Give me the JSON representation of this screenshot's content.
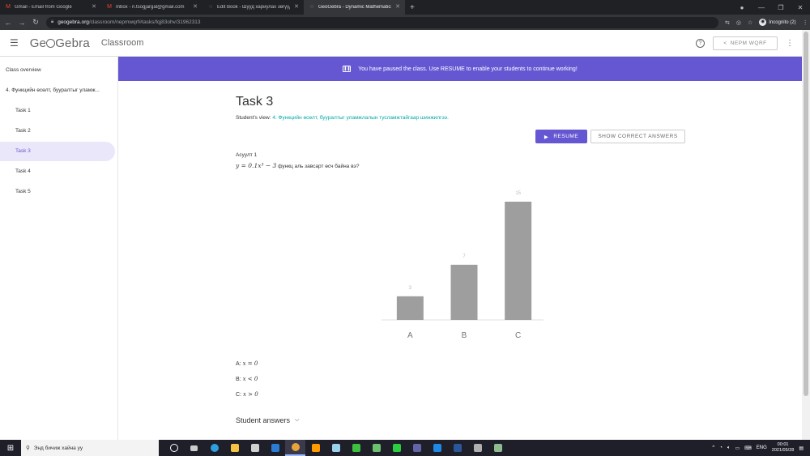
{
  "browser": {
    "tabs": [
      {
        "title": "Gmail - Email from Google",
        "icon": "gmail-icon",
        "active": false
      },
      {
        "title": "Inbox - n.tsogjargal@gmail.com",
        "icon": "gmail-icon",
        "active": false
      },
      {
        "title": "Edit Book - Шууд хариулах зөгүүд",
        "icon": "geogebra-icon",
        "active": false
      },
      {
        "title": "GeoGebra - Dynamic Mathematics",
        "icon": "geogebra-icon",
        "active": true
      }
    ],
    "new_tab": "+",
    "url_domain": "geogebra.org",
    "url_path": "/classroom/nepmwqrf#tasks/fqj83ohv/31962313",
    "profile_label": "Incognito (2)"
  },
  "app": {
    "logo_pre": "Ge",
    "logo_post": "Gebra",
    "section": "Classroom",
    "share_label": "NEPM WQRF"
  },
  "sidebar": {
    "overview": "Class overview",
    "lesson": "4. Функцийн өсөлт, буурaлтыг уламж...",
    "tasks": [
      "Task 1",
      "Task 2",
      "Task 3",
      "Task 4",
      "Task 5"
    ],
    "active_index": 2
  },
  "banner": {
    "text": "You have paused the class. Use RESUME to enable your students to continue working!"
  },
  "task": {
    "title": "Task 3",
    "student_view_label": "Student's view:",
    "student_view_link": "4. Функцийн өсөлт, бууралтыг уламжлалын тусламжтайгаар шинжилгээ.",
    "resume_label": "RESUME",
    "show_answers_label": "SHOW CORRECT ANSWERS",
    "question_label": "Асуулт 1",
    "question_math": "y = 0.1x³ − 3",
    "question_text": "функц аль завсарт өсч байна вэ?",
    "options": [
      {
        "key": "A:",
        "math": "x = 0"
      },
      {
        "key": "B:",
        "math": "x < 0"
      },
      {
        "key": "C:",
        "math": "x > 0"
      }
    ],
    "student_answers_label": "Student answers"
  },
  "chart_data": {
    "type": "bar",
    "categories": [
      "A",
      "B",
      "C"
    ],
    "values": [
      3,
      7,
      15
    ],
    "ylim": [
      0,
      15
    ],
    "grid": false,
    "bar_color": "#9e9e9e"
  },
  "taskbar": {
    "search_placeholder": "Энд бичиж хайна уу",
    "language": "ENG",
    "time": "00:01",
    "date": "2021/05/28"
  },
  "colors": {
    "accent": "#6557d2",
    "link": "#00a8a8"
  }
}
